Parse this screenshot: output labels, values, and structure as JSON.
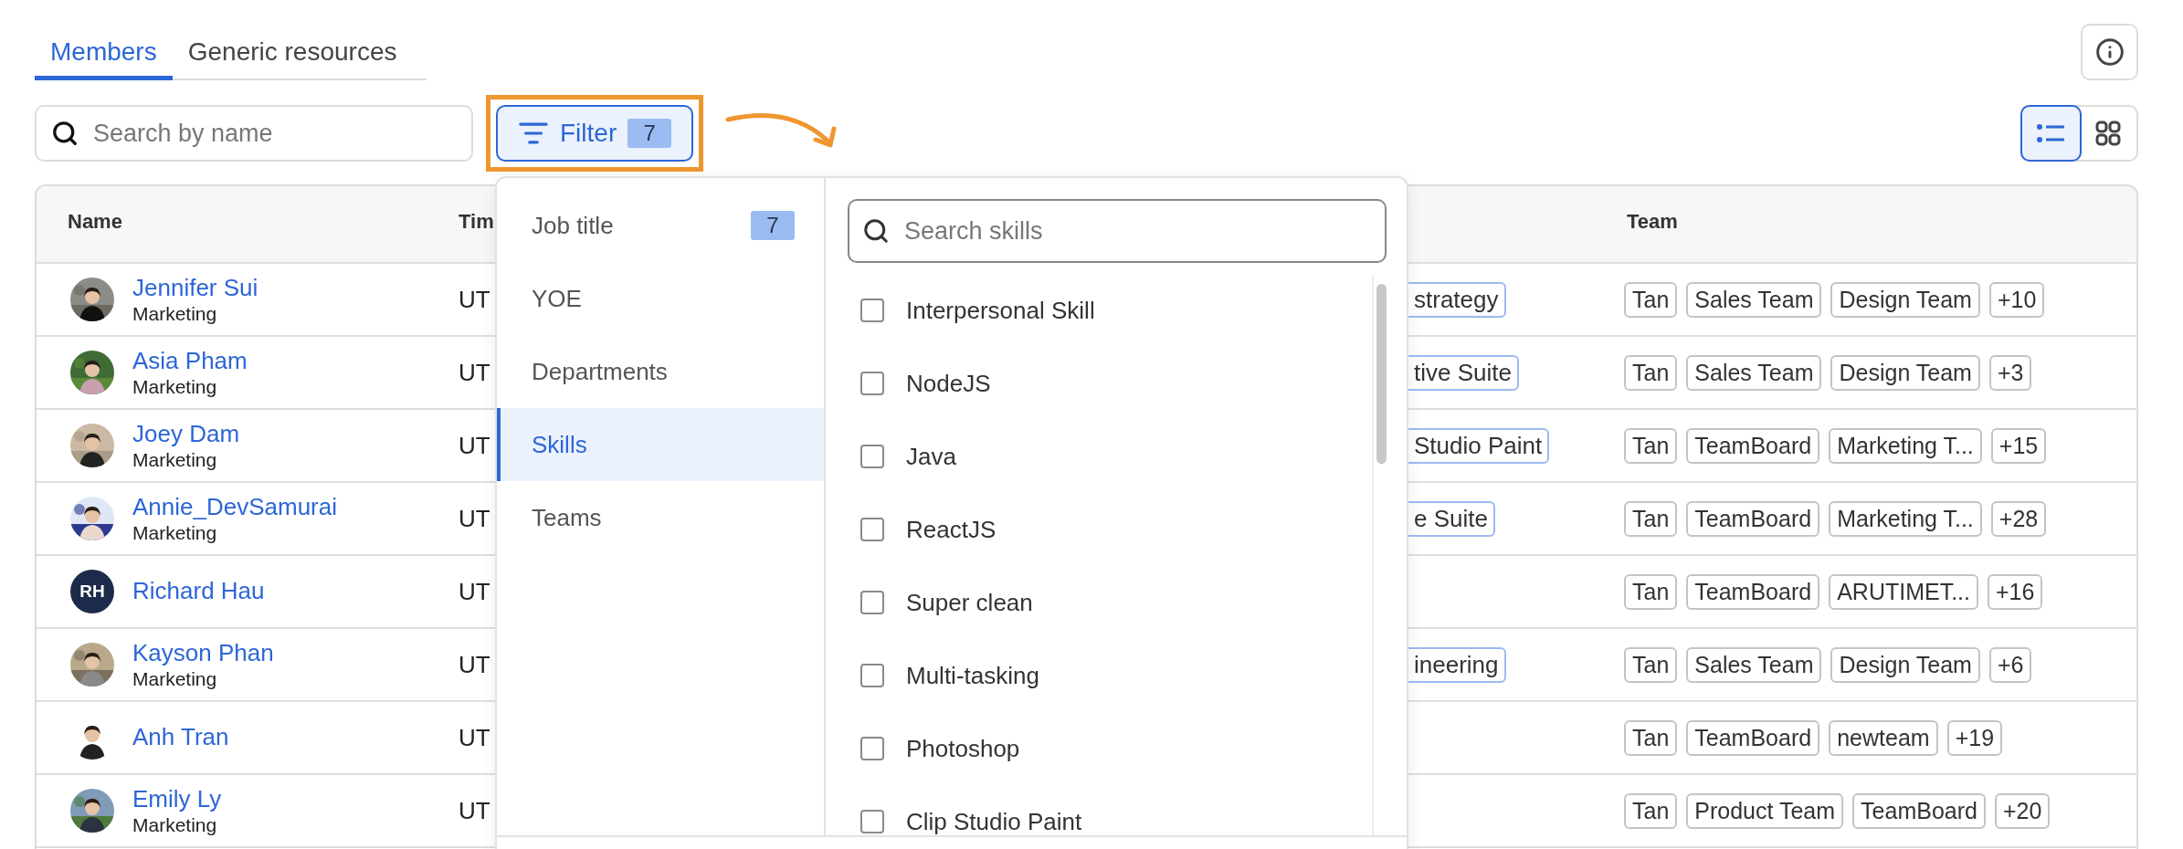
{
  "tabs": [
    {
      "label": "Members",
      "selected": true
    },
    {
      "label": "Generic resources",
      "selected": false
    }
  ],
  "search": {
    "placeholder": "Search by name"
  },
  "filter_button": {
    "label": "Filter",
    "count": "7",
    "highlighted": true
  },
  "view_toggle": [
    {
      "kind": "list",
      "selected": true
    },
    {
      "kind": "grid",
      "selected": false
    }
  ],
  "table": {
    "columns": [
      {
        "kind": "name",
        "label": "Name"
      },
      {
        "kind": "time",
        "label": "Tim"
      },
      {
        "kind": "team",
        "label": "Team"
      }
    ],
    "rows": [
      {
        "name": "Jennifer Sui",
        "department": "Marketing",
        "avatar": {
          "kind": "picture"
        },
        "time": "UT",
        "column_3": "strategy",
        "teams": [
          "Tan",
          "Sales Team",
          "Design Team",
          "+10"
        ]
      },
      {
        "name": "Asia Pham",
        "department": "Marketing",
        "avatar": {
          "kind": "picture"
        },
        "time": "UT",
        "column_3": "tive Suite",
        "teams": [
          "Tan",
          "Sales Team",
          "Design Team",
          "+3"
        ]
      },
      {
        "name": "Joey Dam",
        "department": "Marketing",
        "avatar": {
          "kind": "picture"
        },
        "time": "UT",
        "column_3": "Studio Paint",
        "teams": [
          "Tan",
          "TeamBoard",
          "Marketing T...",
          "+15"
        ]
      },
      {
        "name": "Annie_DevSamurai",
        "department": "Marketing",
        "avatar": {
          "kind": "picture"
        },
        "time": "UT",
        "column_3": "e Suite",
        "teams": [
          "Tan",
          "TeamBoard",
          "Marketing T...",
          "+28"
        ]
      },
      {
        "name": "Richard Hau",
        "avatar": {
          "kind": "initials",
          "text": "RH"
        },
        "time": "UT",
        "teams": [
          "Tan",
          "TeamBoard",
          "ARUTIMET...",
          "+16"
        ]
      },
      {
        "name": "Kayson Phan",
        "department": "Marketing",
        "avatar": {
          "kind": "picture"
        },
        "time": "UT",
        "column_3": "ineering",
        "teams": [
          "Tan",
          "Sales Team",
          "Design Team",
          "+6"
        ]
      },
      {
        "name": "Anh Tran",
        "avatar": {
          "kind": "picture"
        },
        "time": "UT",
        "teams": [
          "Tan",
          "TeamBoard",
          "newteam",
          "+19"
        ]
      },
      {
        "name": "Emily Ly",
        "department": "Marketing",
        "avatar": {
          "kind": "picture"
        },
        "time": "UT",
        "teams": [
          "Tan",
          "Product Team",
          "TeamBoard",
          "+20"
        ]
      }
    ]
  },
  "filter_menu": {
    "categories": [
      {
        "label": "Job title",
        "count": "7",
        "selected": false
      },
      {
        "label": "YOE",
        "selected": false
      },
      {
        "label": "Departments",
        "selected": false
      },
      {
        "label": "Skills",
        "selected": true
      },
      {
        "label": "Teams",
        "selected": false
      }
    ],
    "search": {
      "placeholder": "Search skills"
    },
    "options": [
      {
        "label": "Interpersonal Skill",
        "checked": false
      },
      {
        "label": "NodeJS",
        "checked": false
      },
      {
        "label": "Java",
        "checked": false
      },
      {
        "label": "ReactJS",
        "checked": false
      },
      {
        "label": "Super clean",
        "checked": false
      },
      {
        "label": "Multi-tasking",
        "checked": false
      },
      {
        "label": "Photoshop",
        "checked": false
      },
      {
        "label": "Clip Studio Paint",
        "checked": false
      }
    ]
  }
}
